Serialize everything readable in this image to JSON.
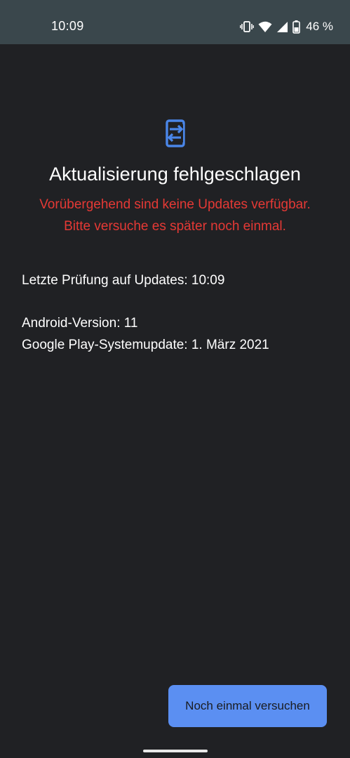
{
  "status_bar": {
    "time": "10:09",
    "battery_percent": "46 %",
    "icons": [
      "vibrate-icon",
      "wifi-icon",
      "signal-icon",
      "battery-icon"
    ]
  },
  "main": {
    "icon": "system-update-icon",
    "title": "Aktualisierung fehlgeschlagen",
    "error_line1": "Vorübergehend sind keine Updates verfügbar.",
    "error_line2": "Bitte versuche es später noch einmal.",
    "last_check": "Letzte Prüfung auf Updates: 10:09",
    "android_version": "Android-Version: 11",
    "play_update": "Google Play-Systemupdate: 1. März 2021"
  },
  "actions": {
    "retry_label": "Noch einmal versuchen"
  },
  "colors": {
    "background": "#202124",
    "status_bar": "#3a474c",
    "error": "#e53935",
    "accent": "#5b8ff2",
    "icon_blue": "#4a86e8"
  }
}
